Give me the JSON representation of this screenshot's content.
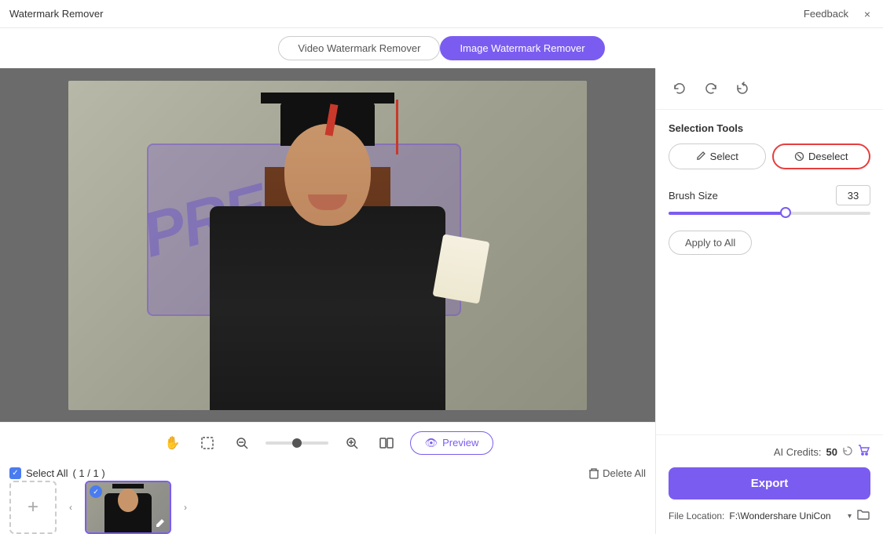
{
  "titleBar": {
    "appTitle": "Watermark Remover",
    "feedbackLabel": "Feedback",
    "closeIcon": "×"
  },
  "tabs": [
    {
      "id": "video",
      "label": "Video Watermark Remover",
      "active": false
    },
    {
      "id": "image",
      "label": "Image Watermark Remover",
      "active": true
    }
  ],
  "toolbar": {
    "undoIcon": "↩",
    "redoIcon": "↪",
    "refreshIcon": "↻"
  },
  "selectionTools": {
    "title": "Selection Tools",
    "selectLabel": "Select",
    "deselectLabel": "Deselect"
  },
  "brushSize": {
    "label": "Brush Size",
    "value": "33"
  },
  "applyToAll": {
    "label": "Apply to All"
  },
  "aiCredits": {
    "label": "AI Credits:",
    "count": "50"
  },
  "exportBtn": {
    "label": "Export"
  },
  "fileLocation": {
    "label": "File Location:",
    "path": "F:\\Wondershare UniCon"
  },
  "canvasToolbar": {
    "panIcon": "✋",
    "selectIcon": "⬜",
    "zoomOutIcon": "−",
    "zoomInIcon": "+",
    "splitIcon": "⊞",
    "previewLabel": "Preview",
    "eyeIcon": "👁"
  },
  "filmstrip": {
    "selectAllLabel": "Select All",
    "count": "( 1 / 1 )",
    "deleteAllLabel": "Delete All",
    "addIcon": "+",
    "navLeftIcon": "‹",
    "navRightIcon": "›"
  },
  "watermark": {
    "text": "PRE"
  }
}
